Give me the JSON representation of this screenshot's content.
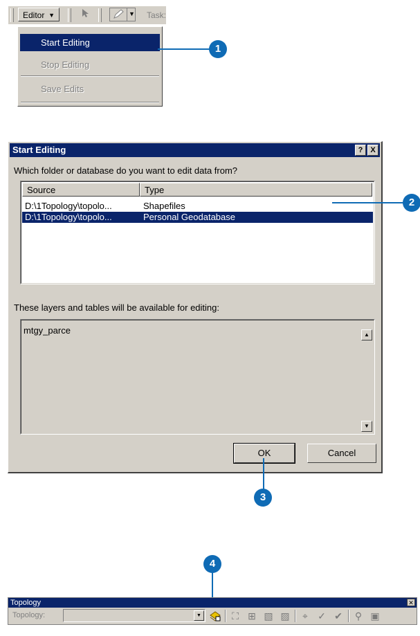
{
  "editor_toolbar": {
    "editor_label": "Editor",
    "task_label": "Task:"
  },
  "editor_menu": {
    "items": [
      {
        "label": "Start Editing",
        "state": "highlighted"
      },
      {
        "label": "Stop Editing",
        "state": "disabled"
      },
      {
        "label": "Save Edits",
        "state": "disabled"
      }
    ]
  },
  "callouts": [
    "1",
    "2",
    "3",
    "4"
  ],
  "dialog": {
    "title": "Start Editing",
    "help_button": "?",
    "close_button": "X",
    "prompt": "Which folder or database do you want to edit data from?",
    "columns": [
      "Source",
      "Type"
    ],
    "rows": [
      {
        "source": "D:\\1Topology\\topolo...",
        "type": "Shapefiles",
        "selected": false
      },
      {
        "source": "D:\\1Topology\\topolo...",
        "type": "Personal Geodatabase",
        "selected": true
      }
    ],
    "layers_prompt": "These layers and tables will be available for editing:",
    "layers": [
      "mtgy_parce"
    ],
    "ok_label": "OK",
    "cancel_label": "Cancel"
  },
  "topology_toolbar": {
    "title": "Topology",
    "label": "Topology:",
    "combo_value": ""
  },
  "colors": {
    "accent": "#0f6bb5",
    "selection": "#0a246a",
    "face": "#d4d0c8"
  }
}
